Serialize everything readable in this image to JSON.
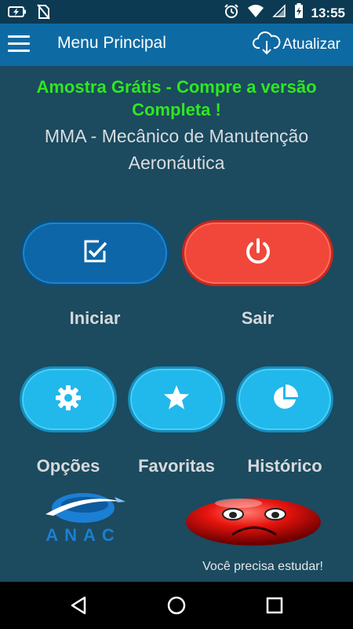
{
  "status_bar": {
    "time": "13:55",
    "icons": [
      "battery-charging-icon",
      "no-sim-icon",
      "alarm-icon",
      "wifi-icon",
      "signal-icon",
      "battery-icon"
    ]
  },
  "app_bar": {
    "title": "Menu Principal",
    "update_label": "Atualizar",
    "icons": [
      "menu-icon",
      "cloud-download-icon"
    ]
  },
  "banner": {
    "promo_line1": "Amostra Grátis - Compre a versão",
    "promo_line2": "Completa !",
    "subject_line1": "MMA - Mecânico de Manutenção",
    "subject_line2": "Aeronáutica"
  },
  "main_buttons": {
    "start_label": "Iniciar",
    "exit_label": "Sair",
    "icons": [
      "checkbox-icon",
      "power-icon"
    ]
  },
  "secondary_buttons": {
    "options_label": "Opções",
    "favorites_label": "Favoritas",
    "history_label": "Histórico",
    "icons": [
      "gear-icon",
      "star-icon",
      "pie-chart-icon"
    ]
  },
  "footer": {
    "logo_text": "ANAC",
    "message": "Você precisa estudar!"
  },
  "colors": {
    "background": "#1c4a5f",
    "app_bar": "#0d6aa3",
    "promo_text": "#2ee81f",
    "start_button": "#0d66a8",
    "exit_button": "#f0473a",
    "secondary_button": "#21b8ec"
  },
  "nav_bar": {
    "icons": [
      "back-icon",
      "home-icon",
      "recents-icon"
    ]
  }
}
